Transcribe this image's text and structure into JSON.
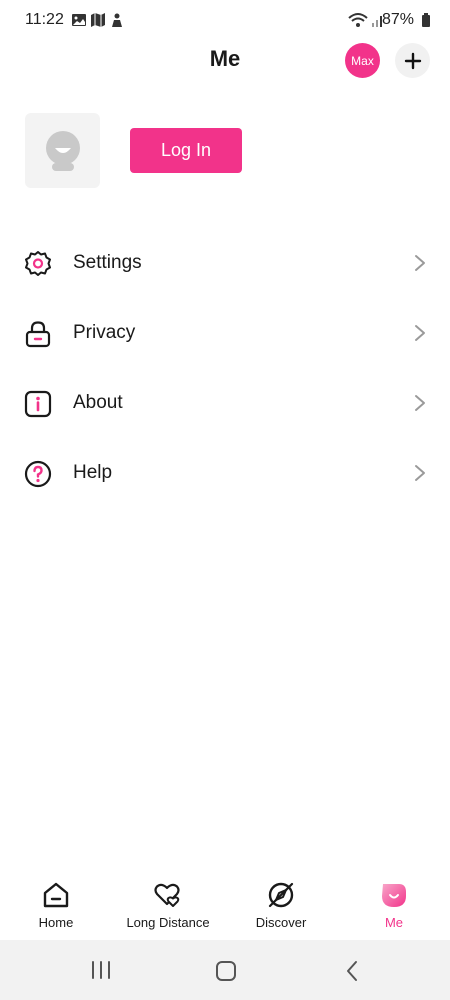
{
  "status_bar": {
    "time": "11:22",
    "battery": "87%",
    "icons": [
      "image-icon",
      "map-icon",
      "person-icon",
      "wifi-icon",
      "signal-icon",
      "battery-icon"
    ]
  },
  "header": {
    "title": "Me",
    "avatar_label": "Max",
    "add_icon": "plus-icon"
  },
  "profile": {
    "login_label": "Log In",
    "avatar_icon": "default-avatar-icon"
  },
  "menu": [
    {
      "label": "Settings",
      "icon": "gear-icon"
    },
    {
      "label": "Privacy",
      "icon": "lock-icon"
    },
    {
      "label": "About",
      "icon": "info-icon"
    },
    {
      "label": "Help",
      "icon": "help-icon"
    }
  ],
  "bottom_nav": [
    {
      "label": "Home",
      "icon": "home-icon"
    },
    {
      "label": "Long Distance",
      "icon": "hearts-icon"
    },
    {
      "label": "Discover",
      "icon": "compass-icon"
    },
    {
      "label": "Me",
      "icon": "me-icon",
      "active": true
    }
  ],
  "colors": {
    "accent": "#f2338a",
    "text": "#1a1a1a",
    "chevron": "#9a9a9a",
    "system_nav_bg": "#f2f2f2"
  }
}
